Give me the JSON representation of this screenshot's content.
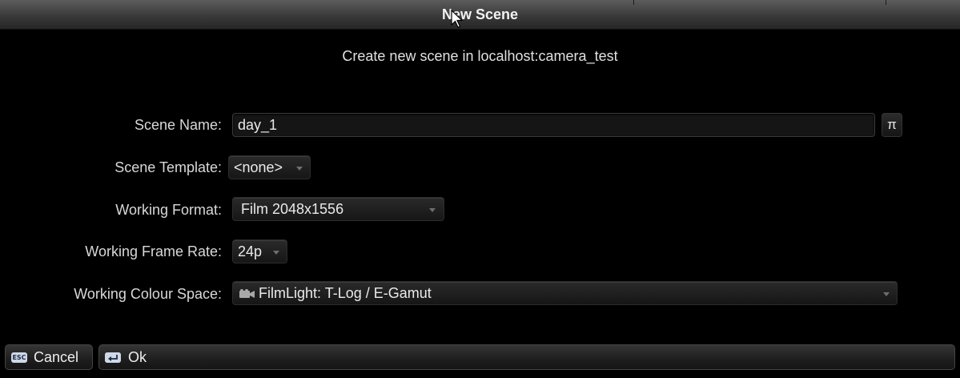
{
  "dialog": {
    "title": "New Scene",
    "subtitle": "Create new scene in localhost:camera_test"
  },
  "form": {
    "scene_name": {
      "label": "Scene Name:",
      "value": "day_1",
      "button_label": "π"
    },
    "scene_template": {
      "label": "Scene Template:",
      "value": "<none>"
    },
    "working_format": {
      "label": "Working Format:",
      "value": "Film 2048x1556"
    },
    "working_frame_rate": {
      "label": "Working Frame Rate:",
      "value": "24p"
    },
    "working_colour_space": {
      "label": "Working Colour Space:",
      "value": "FilmLight: T-Log / E-Gamut",
      "icon": "camera-icon"
    }
  },
  "buttons": {
    "cancel": {
      "label": "Cancel",
      "key": "ESC"
    },
    "ok": {
      "label": "Ok",
      "key": "return"
    }
  }
}
